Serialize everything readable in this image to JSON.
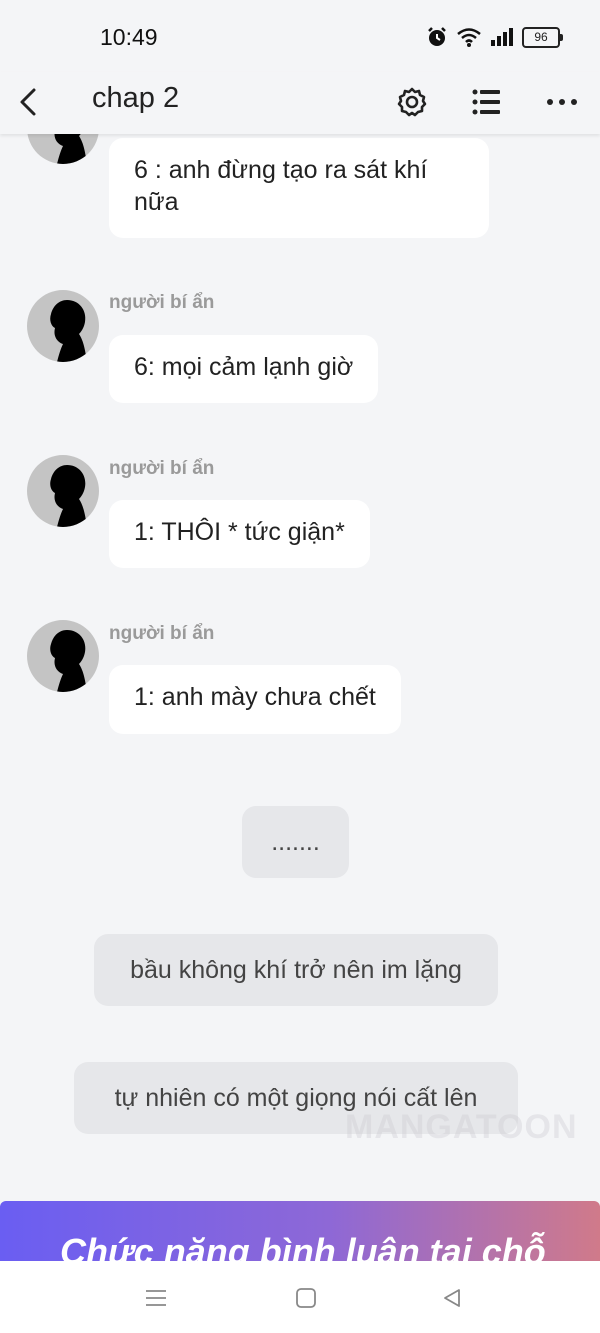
{
  "status_bar": {
    "time": "10:49",
    "battery": "96",
    "icons": [
      "alarm-icon",
      "wifi-icon",
      "signal-icon",
      "battery-icon"
    ]
  },
  "header": {
    "title": "chap 2",
    "icons": [
      "back-icon",
      "settings-icon",
      "chapter-list-icon",
      "more-icon"
    ]
  },
  "messages": [
    {
      "sender": "",
      "text": "6 : anh đừng tạo ra sát khí nữa"
    },
    {
      "sender": "người bí ẩn",
      "text": "6: mọi cảm lạnh giờ"
    },
    {
      "sender": "người bí ẩn",
      "text": "1: THÔI * tức giận*"
    },
    {
      "sender": "người bí ẩn",
      "text": "1: anh mày chưa chết"
    }
  ],
  "system_messages": [
    ".......",
    "bầu không khí trở nên im lặng",
    "tự nhiên có một giọng nói cất lên"
  ],
  "watermark": "MANGATOON",
  "banner": {
    "text": "Chức năng bình luận tại chỗ"
  },
  "nav_bar": {
    "icons": [
      "menu-icon",
      "home-icon",
      "back-triangle-icon"
    ]
  },
  "colors": {
    "background": "#f4f5f7",
    "bubble": "#ffffff",
    "system_bubble": "#e6e7ea",
    "banner_start": "#6a5ef2",
    "banner_end": "#d07a8a"
  }
}
